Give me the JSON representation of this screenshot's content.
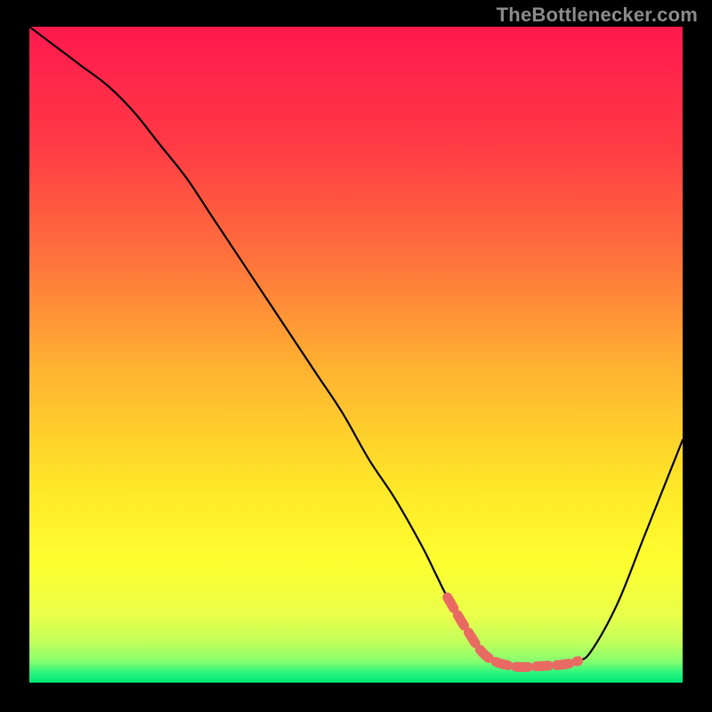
{
  "attribution": "TheBottlenecker.com",
  "colors": {
    "background": "#000000",
    "attribution_text": "#8b8b8b",
    "curve_stroke": "#000000",
    "gradient_stops": [
      {
        "offset": 0.0,
        "color": "#ff194e"
      },
      {
        "offset": 0.18,
        "color": "#ff3a45"
      },
      {
        "offset": 0.35,
        "color": "#ff713c"
      },
      {
        "offset": 0.52,
        "color": "#ffb231"
      },
      {
        "offset": 0.7,
        "color": "#ffe728"
      },
      {
        "offset": 0.82,
        "color": "#fdff30"
      },
      {
        "offset": 0.9,
        "color": "#e8ff4b"
      },
      {
        "offset": 0.94,
        "color": "#bfff5c"
      },
      {
        "offset": 0.968,
        "color": "#85ff70"
      },
      {
        "offset": 0.985,
        "color": "#29f57c"
      },
      {
        "offset": 1.0,
        "color": "#00e676"
      }
    ],
    "accent_thick": "#e86a63"
  },
  "chart_data": {
    "type": "line",
    "title": "",
    "xlabel": "",
    "ylabel": "",
    "xlim": [
      0,
      100
    ],
    "ylim": [
      0,
      100
    ],
    "series": [
      {
        "name": "bottleneck-curve",
        "x": [
          0,
          4,
          8,
          12,
          16,
          20,
          24,
          28,
          32,
          36,
          40,
          44,
          48,
          52,
          56,
          60,
          62,
          64,
          67,
          70,
          74,
          78,
          82,
          84,
          86,
          90,
          94,
          98,
          100
        ],
        "y": [
          100,
          97,
          94,
          91,
          87,
          82,
          77,
          71,
          65,
          59,
          53,
          47,
          41,
          34,
          28,
          21,
          17,
          13,
          8,
          4,
          2.5,
          2.5,
          2.8,
          3.3,
          4.8,
          12,
          22,
          32,
          37
        ]
      }
    ],
    "accent_segment": {
      "name": "optimal-band",
      "x": [
        64,
        67,
        70,
        74,
        78,
        82,
        84
      ],
      "y": [
        13,
        8,
        4,
        2.5,
        2.5,
        2.8,
        3.3
      ]
    }
  }
}
